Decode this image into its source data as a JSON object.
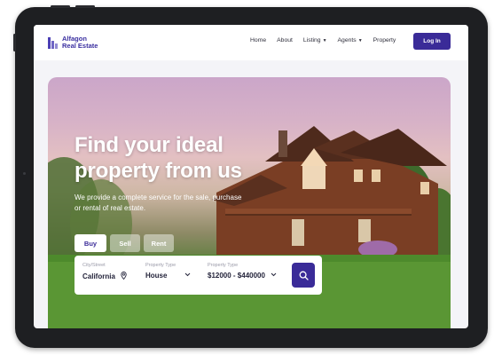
{
  "brand": {
    "line1": "Alfagon",
    "line2": "Real Estate",
    "color": "#3a2fa0"
  },
  "nav": {
    "items": [
      {
        "label": "Home",
        "dropdown": false
      },
      {
        "label": "About",
        "dropdown": false
      },
      {
        "label": "Listing",
        "dropdown": true
      },
      {
        "label": "Agents",
        "dropdown": true
      },
      {
        "label": "Property",
        "dropdown": false
      }
    ],
    "login_label": "Log In"
  },
  "hero": {
    "title_line1": "Find your ideal",
    "title_line2": "property from us",
    "subtitle": "We provide a complete service for the sale, purchase or rental of real estate."
  },
  "tabs": [
    {
      "label": "Buy",
      "active": true
    },
    {
      "label": "Sell",
      "active": false
    },
    {
      "label": "Rent",
      "active": false
    }
  ],
  "search": {
    "city": {
      "label": "City/Street",
      "value": "California",
      "icon": "location-pin-icon"
    },
    "type": {
      "label": "Property Type",
      "value": "House",
      "icon": "chevron-down-icon"
    },
    "price": {
      "label": "Property Type",
      "value": "$12000 - $440000",
      "icon": "chevron-down-icon"
    },
    "button_icon": "search-icon"
  },
  "colors": {
    "primary": "#3a2b98",
    "frame": "#1e1f22",
    "screen_bg": "#f4f4f8"
  }
}
